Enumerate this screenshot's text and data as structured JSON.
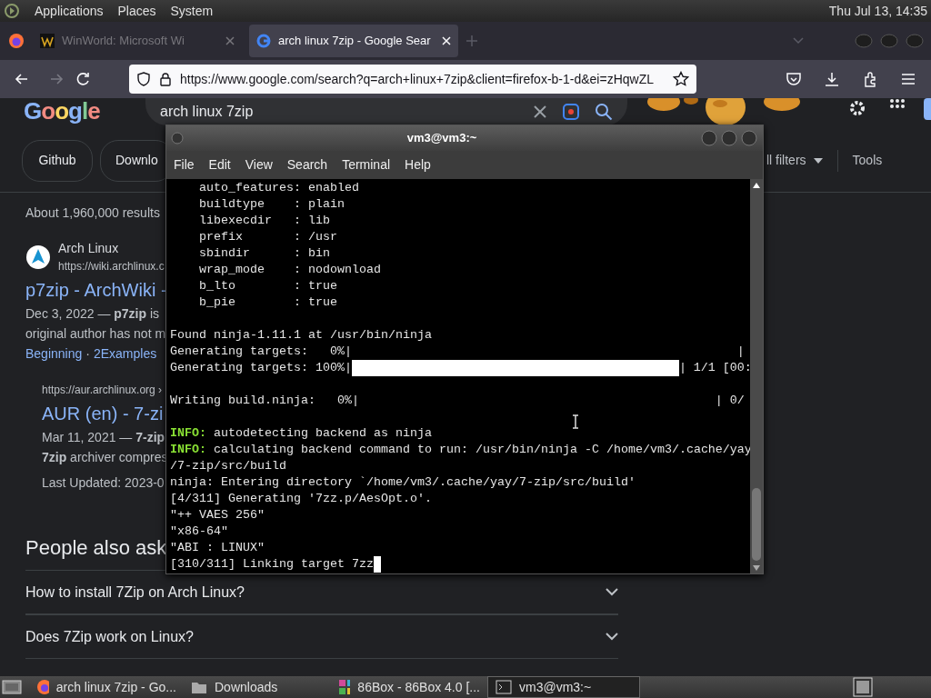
{
  "top_panel": {
    "menus": [
      "Applications",
      "Places",
      "System"
    ],
    "clock": "Thu Jul 13, 14:35"
  },
  "browser": {
    "tabs": [
      {
        "title": "WinWorld: Microsoft Wi",
        "kind": "winworld",
        "selected": false
      },
      {
        "title": "arch linux 7zip - Google Sear",
        "kind": "google",
        "selected": true
      }
    ],
    "url": "https://www.google.com/search?q=arch+linux+7zip&client=firefox-b-1-d&ei=zHqwZL",
    "forward_disabled": true
  },
  "google": {
    "logo": "Google",
    "query": "arch linux 7zip",
    "chips": [
      "Github",
      "Downlo"
    ],
    "all_filters": "ll filters",
    "tools": "Tools",
    "result_count": "About 1,960,000 results",
    "results": [
      {
        "site": "Arch Linux",
        "url": "https://wiki.archlinux.c",
        "title": "p7zip - ArchWiki -",
        "snippet": [
          "Dec 3, 2022 — **p7zip** is",
          "original author has not m"
        ],
        "links": [
          "Beginning",
          "2Examples"
        ],
        "link_separator": "·",
        "kind": "main"
      },
      {
        "url": "https://aur.archlinux.org ›",
        "title": "AUR (en) - 7-zi",
        "snippet": [
          "Mar 11, 2021 — **7-zip**",
          "**7zip** archiver compres"
        ],
        "meta": "Last Updated: 2023-0",
        "kind": "sub"
      }
    ],
    "people_also_ask": {
      "heading": "People also ask",
      "questions": [
        "How to install 7Zip on Arch Linux?",
        "Does 7Zip work on Linux?"
      ]
    }
  },
  "terminal": {
    "title": "vm3@vm3:~",
    "menus": [
      "File",
      "Edit",
      "View",
      "Search",
      "Terminal",
      "Help"
    ],
    "cursor_visible": true,
    "lines": [
      {
        "kind": "text",
        "text": "    auto_features: enabled"
      },
      {
        "kind": "text",
        "text": "    buildtype    : plain"
      },
      {
        "kind": "text",
        "text": "    libexecdir   : lib"
      },
      {
        "kind": "text",
        "text": "    prefix       : /usr"
      },
      {
        "kind": "text",
        "text": "    sbindir      : bin"
      },
      {
        "kind": "text",
        "text": "    wrap_mode    : nodownload"
      },
      {
        "kind": "text",
        "text": "    b_lto        : true"
      },
      {
        "kind": "text",
        "text": "    b_pie        : true"
      },
      {
        "kind": "blank"
      },
      {
        "kind": "text",
        "text": "Found ninja-1.11.1 at /usr/bin/ninja"
      },
      {
        "kind": "text",
        "text": "Generating targets:   0%|                                                     |"
      },
      {
        "kind": "progress",
        "text": "Generating targets: 100%|",
        "level": 1,
        "end": "| 1/1 [00:"
      },
      {
        "kind": "blank"
      },
      {
        "kind": "text",
        "text": "Writing build.ninja:   0%|                                                 | 0/"
      },
      {
        "kind": "blank"
      },
      {
        "kind": "info",
        "label": "INFO:",
        "text": " autodetecting backend as ninja"
      },
      {
        "kind": "info",
        "label": "INFO:",
        "text": " calculating backend command to run: /usr/bin/ninja -C /home/vm3/.cache/yay"
      },
      {
        "kind": "text",
        "text": "/7-zip/src/build"
      },
      {
        "kind": "text",
        "text": "ninja: Entering directory `/home/vm3/.cache/yay/7-zip/src/build'"
      },
      {
        "kind": "text",
        "text": "[4/311] Generating '7zz.p/AesOpt.o'."
      },
      {
        "kind": "text",
        "text": "\"++ VAES 256\""
      },
      {
        "kind": "text",
        "text": "\"x86-64\""
      },
      {
        "kind": "text",
        "text": "\"ABI : LINUX\""
      },
      {
        "kind": "text",
        "text": "[310/311] Linking target 7zz"
      }
    ]
  },
  "taskbar": {
    "items": [
      {
        "label": "arch linux 7zip - Go...",
        "kind": "firefox",
        "selected": false
      },
      {
        "label": "Downloads",
        "kind": "folder",
        "selected": false
      },
      {
        "label": "86Box - 86Box 4.0 [...",
        "kind": "emulator",
        "selected": false
      },
      {
        "label": "vm3@vm3:~",
        "kind": "terminal",
        "selected": true
      }
    ]
  }
}
